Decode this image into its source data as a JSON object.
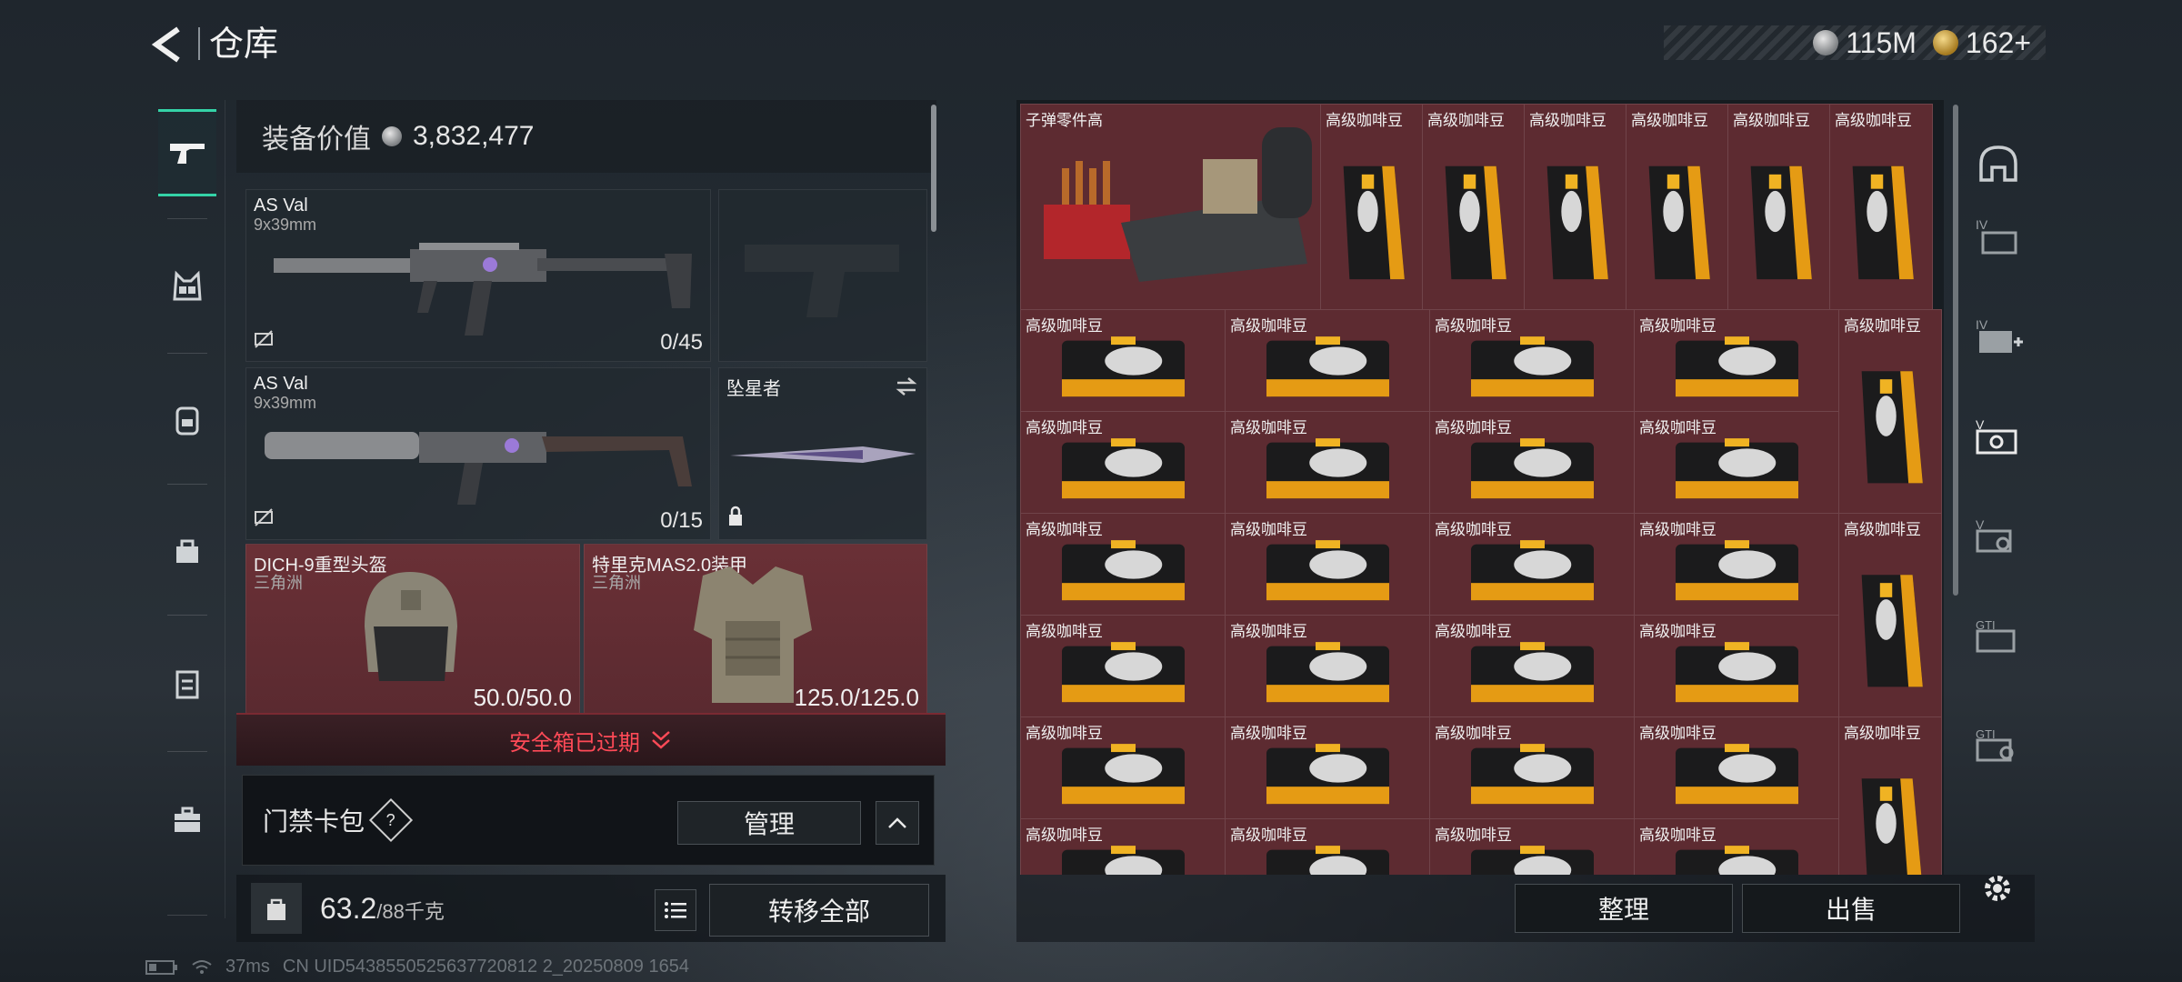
{
  "header": {
    "title": "仓库"
  },
  "currency": {
    "silver": "115M",
    "gold": "162+"
  },
  "equipment": {
    "value_label": "装备价值",
    "value": "3,832,477",
    "slots": {
      "primary": {
        "name": "AS Val",
        "caliber": "9x39mm",
        "ammo": "0/45"
      },
      "secondary": {
        "name": "AS Val",
        "caliber": "9x39mm",
        "ammo": "0/15"
      },
      "melee": {
        "name": "坠星者"
      },
      "helmet": {
        "name": "DICH-9重型头盔",
        "origin": "三角洲",
        "durability": "50.0/50.0"
      },
      "armor": {
        "name": "特里克MAS2.0装甲",
        "origin": "三角洲",
        "durability": "125.0/125.0"
      }
    }
  },
  "safe_box": {
    "status": "安全箱已过期"
  },
  "keycard": {
    "label": "门禁卡包",
    "help": "?",
    "manage_label": "管理"
  },
  "backpack": {
    "weight": "63.2",
    "max": "/88千克",
    "transfer_label": "转移全部"
  },
  "stash": {
    "big_item": "子弹零件高",
    "coffee": "高级咖啡豆",
    "sort_label": "整理",
    "sell_label": "出售"
  },
  "right_rail": {
    "labels": [
      "IV",
      "IV",
      "V",
      "V",
      "GTI",
      "GTI"
    ]
  },
  "status": {
    "ping": "37ms",
    "uid": "CN UID5438550525637720812 2_20250809 1654"
  },
  "colors": {
    "accent": "#34d3a7",
    "item_bg": "#5d2b31",
    "warning": "#ff4a57"
  }
}
